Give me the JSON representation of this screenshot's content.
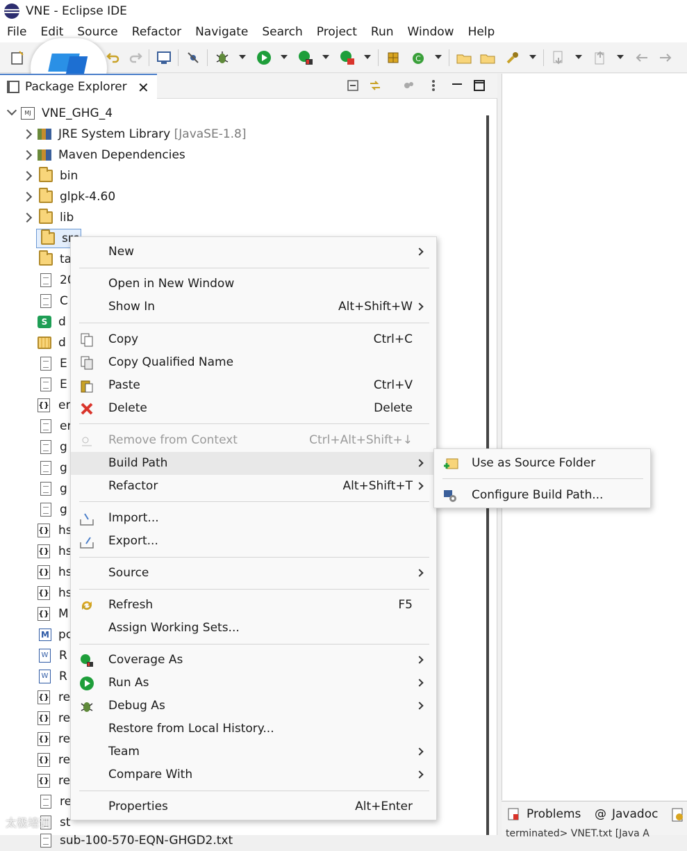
{
  "window": {
    "title": "VNE - Eclipse IDE"
  },
  "menubar": [
    "File",
    "Edit",
    "Source",
    "Refactor",
    "Navigate",
    "Search",
    "Project",
    "Run",
    "Window",
    "Help"
  ],
  "package_explorer": {
    "tab_label": "Package Explorer",
    "project": "VNE_GHG_4",
    "tree": [
      {
        "label": "JRE System Library",
        "suffix": "[JavaSE-1.8]",
        "icon": "library-icon",
        "expandable": true
      },
      {
        "label": "Maven Dependencies",
        "icon": "library-icon",
        "expandable": true
      },
      {
        "label": "bin",
        "icon": "folder-icon",
        "expandable": true
      },
      {
        "label": "glpk-4.60",
        "icon": "folder-icon",
        "expandable": true
      },
      {
        "label": "lib",
        "icon": "folder-icon",
        "expandable": true
      },
      {
        "label": "src",
        "icon": "folder-icon",
        "expandable": false,
        "selected": true
      },
      {
        "label": "ta",
        "icon": "folder-icon"
      },
      {
        "label": "20",
        "icon": "file-icon"
      },
      {
        "label": "C",
        "icon": "file-icon"
      },
      {
        "label": "d",
        "icon": "spreadsheet-icon"
      },
      {
        "label": "d",
        "icon": "archive-folder-icon"
      },
      {
        "label": "E",
        "icon": "file-icon"
      },
      {
        "label": "E",
        "icon": "file-icon"
      },
      {
        "label": "er",
        "icon": "json-file-icon"
      },
      {
        "label": "er",
        "icon": "file-icon"
      },
      {
        "label": "g",
        "icon": "file-icon"
      },
      {
        "label": "g",
        "icon": "file-icon"
      },
      {
        "label": "g",
        "icon": "file-icon"
      },
      {
        "label": "g",
        "icon": "file-icon"
      },
      {
        "label": "hs",
        "icon": "json-file-icon"
      },
      {
        "label": "hs",
        "icon": "json-file-icon"
      },
      {
        "label": "hs",
        "icon": "json-file-icon"
      },
      {
        "label": "hs",
        "icon": "json-file-icon"
      },
      {
        "label": "M",
        "icon": "json-file-icon"
      },
      {
        "label": "pc",
        "icon": "maven-pom-icon"
      },
      {
        "label": "R",
        "icon": "word-doc-icon"
      },
      {
        "label": "R",
        "icon": "word-doc-icon"
      },
      {
        "label": "re",
        "icon": "json-file-icon"
      },
      {
        "label": "re",
        "icon": "json-file-icon"
      },
      {
        "label": "re",
        "icon": "json-file-icon"
      },
      {
        "label": "re",
        "icon": "json-file-icon"
      },
      {
        "label": "re",
        "icon": "json-file-icon"
      },
      {
        "label": "re",
        "icon": "file-icon"
      },
      {
        "label": "st",
        "icon": "file-icon"
      },
      {
        "label": "sub-100-570-EQN-GHGD2.txt",
        "icon": "file-icon"
      }
    ]
  },
  "context_menu": {
    "items": [
      {
        "label": "New",
        "submenu": true
      },
      {
        "separator": true
      },
      {
        "label": "Open in New Window"
      },
      {
        "label": "Show In",
        "shortcut": "Alt+Shift+W",
        "submenu": true
      },
      {
        "separator": true
      },
      {
        "label": "Copy",
        "shortcut": "Ctrl+C",
        "icon": "copy-icon"
      },
      {
        "label": "Copy Qualified Name",
        "icon": "copy-qualified-icon"
      },
      {
        "label": "Paste",
        "shortcut": "Ctrl+V",
        "icon": "paste-icon"
      },
      {
        "label": "Delete",
        "shortcut": "Delete",
        "icon": "delete-icon"
      },
      {
        "separator": true
      },
      {
        "label": "Remove from Context",
        "shortcut": "Ctrl+Alt+Shift+↓",
        "icon": "remove-context-icon",
        "disabled": true
      },
      {
        "label": "Build Path",
        "submenu": true,
        "hover": true
      },
      {
        "label": "Refactor",
        "shortcut": "Alt+Shift+T",
        "submenu": true
      },
      {
        "separator": true
      },
      {
        "label": "Import...",
        "icon": "import-icon"
      },
      {
        "label": "Export...",
        "icon": "export-icon"
      },
      {
        "separator": true
      },
      {
        "label": "Source",
        "submenu": true
      },
      {
        "separator": true
      },
      {
        "label": "Refresh",
        "shortcut": "F5",
        "icon": "refresh-icon"
      },
      {
        "label": "Assign Working Sets..."
      },
      {
        "separator": true
      },
      {
        "label": "Coverage As",
        "submenu": true,
        "icon": "coverage-icon"
      },
      {
        "label": "Run As",
        "submenu": true,
        "icon": "run-icon"
      },
      {
        "label": "Debug As",
        "submenu": true,
        "icon": "debug-icon"
      },
      {
        "label": "Restore from Local History..."
      },
      {
        "label": "Team",
        "submenu": true
      },
      {
        "label": "Compare With",
        "submenu": true
      },
      {
        "separator": true
      },
      {
        "label": "Properties",
        "shortcut": "Alt+Enter"
      }
    ]
  },
  "build_path_submenu": {
    "items": [
      {
        "label": "Use as Source Folder",
        "icon": "source-folder-icon"
      },
      {
        "label": "Configure Build Path...",
        "icon": "configure-build-path-icon"
      }
    ]
  },
  "bottom_panel": {
    "tabs": [
      {
        "label": "Problems",
        "icon": "problems-icon"
      },
      {
        "label": "Javadoc",
        "icon": "javadoc-icon"
      }
    ],
    "status_line": "terminated> VNET.txt [Java A"
  },
  "watermark": "太极培训",
  "colors": {
    "selection_border": "#6a98d4",
    "tab_active_border": "#4a7ec9",
    "run_green": "#1e9e3a",
    "delete_red": "#d9342b"
  }
}
